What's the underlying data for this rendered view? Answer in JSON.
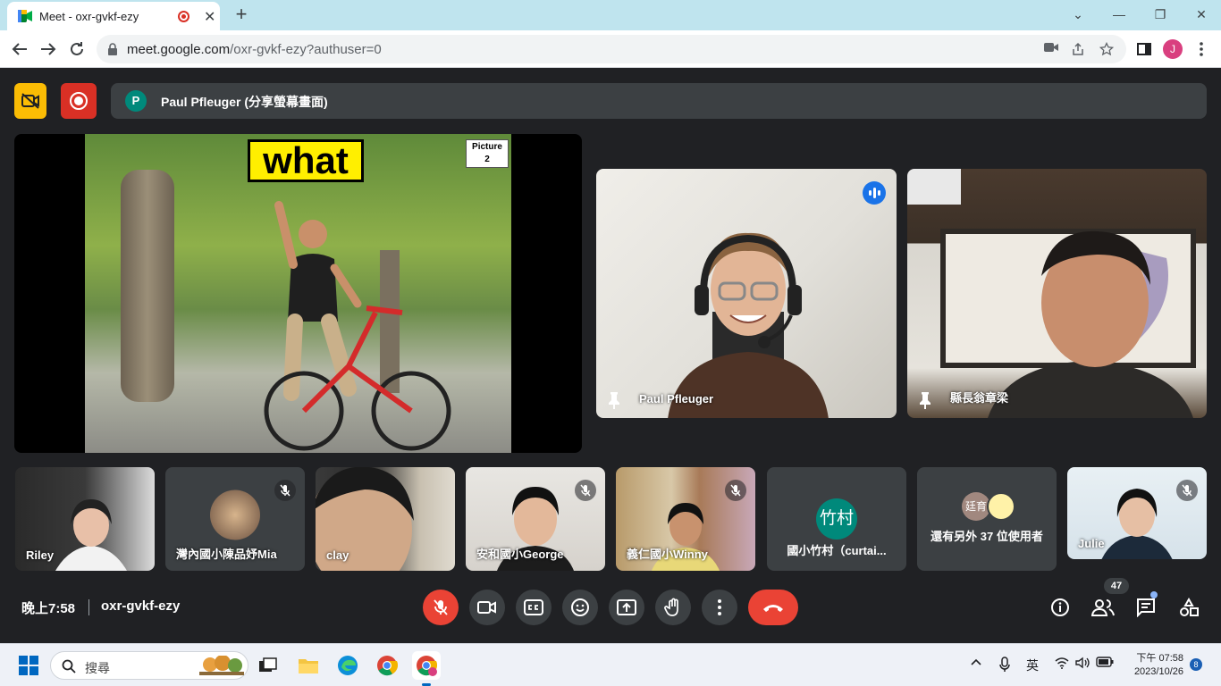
{
  "browser": {
    "tab_title": "Meet - oxr-gvkf-ezy",
    "tab_close": "✕",
    "new_tab": "+",
    "url_host": "meet.google.com",
    "url_path": "/oxr-gvkf-ezy?authuser=0",
    "profile_initial": "J",
    "window_controls": [
      "⌄",
      "—",
      "❐",
      "✕"
    ]
  },
  "meet": {
    "presenter_initial": "P",
    "presenter_banner": "Paul Pfleuger (分享螢幕畫面)",
    "slide": {
      "word": "what",
      "picture_label": "Picture",
      "picture_number": "2"
    },
    "tiles": {
      "paul": "Paul Pfleuger",
      "mayor": "縣長翁章梁"
    },
    "small_tiles": [
      {
        "name": "Riley"
      },
      {
        "name": "灣內國小陳品妤Mia"
      },
      {
        "name": "clay"
      },
      {
        "name": "安和國小George"
      },
      {
        "name": "義仁國小Winny"
      },
      {
        "name": "國小竹村（curtai...",
        "avatar_text": "竹村"
      },
      {
        "name": "還有另外 37 位使用者",
        "avatar_text": "廷育"
      },
      {
        "name": "Julie"
      }
    ],
    "time": "晚上7:58",
    "meeting_code": "oxr-gvkf-ezy",
    "participant_count": "47",
    "colors": {
      "accent_red": "#ea4335",
      "accent_yellow": "#fbbc04",
      "accent_blue": "#1a73e8",
      "avatar_teal": "#00897b"
    }
  },
  "taskbar": {
    "search_placeholder": "搜尋",
    "ime": "英",
    "clock_period_time": "下午 07:58",
    "clock_date": "2023/10/26",
    "notification_count": "8"
  }
}
